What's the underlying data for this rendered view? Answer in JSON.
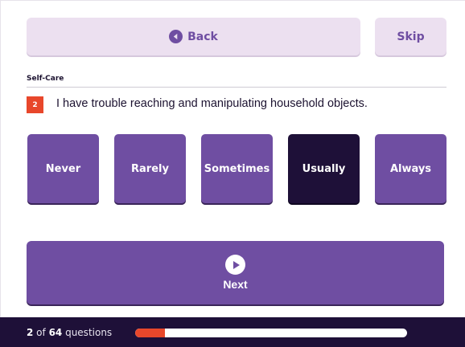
{
  "nav": {
    "back_label": "Back",
    "skip_label": "Skip"
  },
  "section": {
    "title": "Self-Care"
  },
  "question": {
    "number": "2",
    "text": "I have trouble reaching  and manipulating household objects."
  },
  "options": [
    {
      "label": "Never",
      "selected": false
    },
    {
      "label": "Rarely",
      "selected": false
    },
    {
      "label": "Sometimes",
      "selected": false
    },
    {
      "label": "Usually",
      "selected": true
    },
    {
      "label": "Always",
      "selected": false
    }
  ],
  "next": {
    "label": "Next"
  },
  "progress": {
    "current": "2",
    "separator": " of ",
    "total": "64",
    "suffix": " questions",
    "fraction": 0.11
  },
  "colors": {
    "primary": "#6f4ea2",
    "selected": "#1e1038",
    "accent": "#e8472b",
    "light": "#ece0f0"
  },
  "icons": {
    "back": "left-triangle-circle-icon",
    "next": "play-circle-icon"
  }
}
